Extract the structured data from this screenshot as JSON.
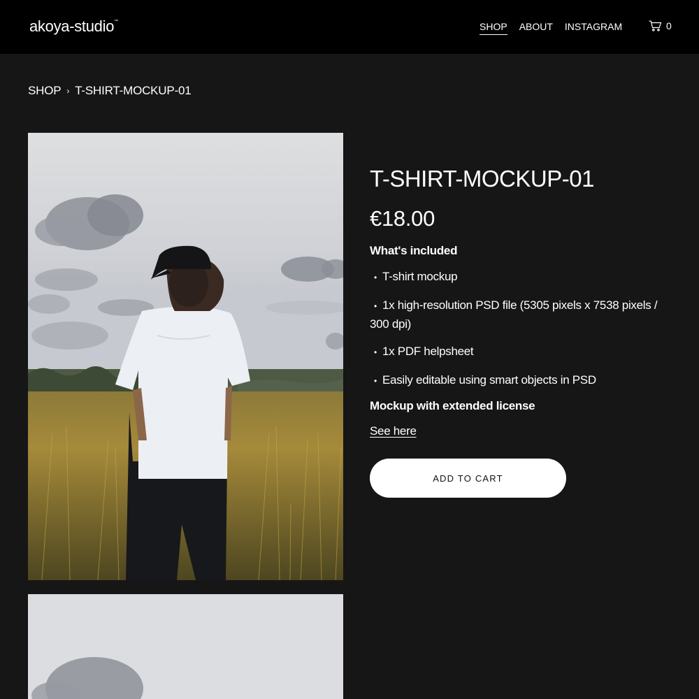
{
  "header": {
    "logo": "akoya-studio",
    "logo_mark": "™",
    "nav": [
      {
        "label": "SHOP",
        "active": true
      },
      {
        "label": "ABOUT",
        "active": false
      },
      {
        "label": "INSTAGRAM",
        "active": false
      }
    ],
    "cart_icon": "cart-icon",
    "cart_count": "0"
  },
  "breadcrumb": {
    "root": "SHOP",
    "separator": "›",
    "current": "T-SHIRT-MOCKUP-01"
  },
  "product": {
    "title": "T-SHIRT-MOCKUP-01",
    "price": "€18.00",
    "included_heading": "What's included",
    "features": [
      "T-shirt mockup",
      "1x high-resolution PSD file (5305 pixels x 7538 pixels / 300 dpi)",
      "1x PDF helpsheet",
      "Easily editable using smart objects in PSD"
    ],
    "extended_heading": "Mockup with extended license",
    "see_here": "See here",
    "add_to_cart": "ADD TO CART"
  },
  "colors": {
    "header_bg": "#000000",
    "page_bg": "#161616",
    "text": "#ffffff",
    "button_bg": "#ffffff",
    "button_text": "#111111"
  }
}
